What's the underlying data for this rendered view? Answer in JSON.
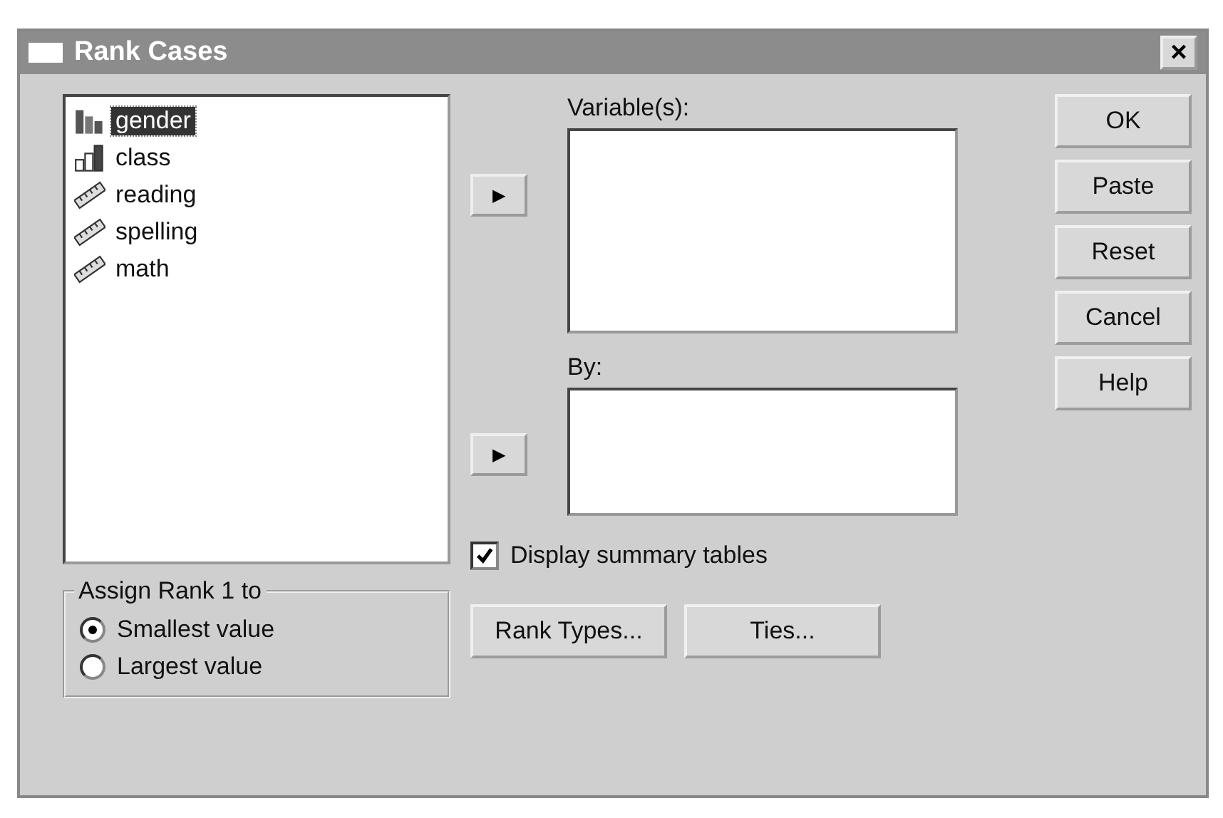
{
  "window": {
    "title": "Rank Cases",
    "close": "×"
  },
  "source_list": {
    "items": [
      {
        "label": "gender",
        "kind": "nominal",
        "selected": true
      },
      {
        "label": "class",
        "kind": "ordinal",
        "selected": false
      },
      {
        "label": "reading",
        "kind": "scale",
        "selected": false
      },
      {
        "label": "spelling",
        "kind": "scale",
        "selected": false
      },
      {
        "label": "math",
        "kind": "scale",
        "selected": false
      }
    ]
  },
  "variables": {
    "label": "Variable(s):",
    "arrow": "▶"
  },
  "by": {
    "label": "By:",
    "arrow": "▶"
  },
  "side_buttons": [
    "OK",
    "Paste",
    "Reset",
    "Cancel",
    "Help"
  ],
  "assign_rank": {
    "title": "Assign Rank 1 to",
    "options": [
      {
        "label": "Smallest value",
        "selected": true
      },
      {
        "label": "Largest value",
        "selected": false
      }
    ]
  },
  "display_summary": {
    "label": "Display summary tables",
    "checked": true
  },
  "bottom_buttons": [
    "Rank Types...",
    "Ties..."
  ]
}
